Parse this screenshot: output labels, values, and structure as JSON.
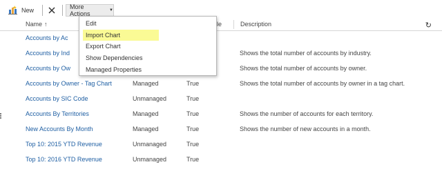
{
  "toolbar": {
    "new_label": "New",
    "delete_label": "✕",
    "more_actions_label": "More Actions",
    "more_actions_caret": "▼"
  },
  "grid": {
    "headers": {
      "name": "Name",
      "sort_arrow": "↑",
      "state_visible": "",
      "default_visible": "le",
      "description": "Description"
    },
    "refresh_icon": "↻",
    "rows": [
      {
        "name": "Accounts by Ac",
        "state": "",
        "default": "",
        "description": ""
      },
      {
        "name": "Accounts by Ind",
        "state": "",
        "default": "",
        "description": "Shows the total number of accounts by industry."
      },
      {
        "name": "Accounts by Ow",
        "state": "",
        "default": "",
        "description": "Shows the total number of accounts by owner."
      },
      {
        "name": "Accounts by Owner - Tag Chart",
        "state": "Managed",
        "default": "True",
        "description": "Shows the total number of accounts by owner in a tag chart."
      },
      {
        "name": "Accounts by SIC Code",
        "state": "Unmanaged",
        "default": "True",
        "description": ""
      },
      {
        "name": "Accounts By Territories",
        "state": "Managed",
        "default": "True",
        "description": "Shows the number of accounts for each territory."
      },
      {
        "name": "New Accounts By Month",
        "state": "Managed",
        "default": "True",
        "description": "Shows the number of new accounts in a month."
      },
      {
        "name": "Top 10: 2015 YTD Revenue",
        "state": "Unmanaged",
        "default": "True",
        "description": ""
      },
      {
        "name": "Top 10: 2016 YTD Revenue",
        "state": "Unmanaged",
        "default": "True",
        "description": ""
      }
    ]
  },
  "menu": {
    "items": [
      "Edit",
      "Import Chart",
      "Export Chart",
      "Show Dependencies",
      "Managed Properties"
    ],
    "highlighted": "Import Chart",
    "highlight_color": "#fafa8a"
  },
  "colors": {
    "link": "#1f5fa3",
    "text": "#444444"
  },
  "icons": {
    "new": "chart-new-icon",
    "delete": "close-icon",
    "refresh": "refresh-icon",
    "caret": "chevron-down-icon"
  }
}
